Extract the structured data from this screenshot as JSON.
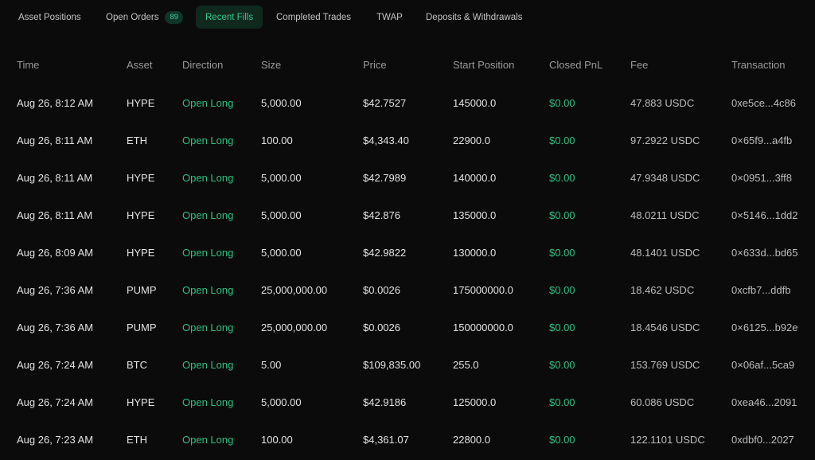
{
  "tabs": [
    {
      "label": "Asset Positions"
    },
    {
      "label": "Open Orders",
      "badge": "89"
    },
    {
      "label": "Recent Fills"
    },
    {
      "label": "Completed Trades"
    },
    {
      "label": "TWAP"
    },
    {
      "label": "Deposits & Withdrawals"
    }
  ],
  "table": {
    "headers": [
      "Time",
      "Asset",
      "Direction",
      "Size",
      "Price",
      "Start Position",
      "Closed PnL",
      "Fee",
      "Transaction"
    ],
    "rows": [
      {
        "time": "Aug 26, 8:12 AM",
        "asset": "HYPE",
        "direction": "Open Long",
        "size": "5,000.00",
        "price": "$42.7527",
        "start": "145000.0",
        "pnl": "$0.00",
        "fee": "47.883 USDC",
        "tx": "0xe5ce...4c86"
      },
      {
        "time": "Aug 26, 8:11 AM",
        "asset": "ETH",
        "direction": "Open Long",
        "size": "100.00",
        "price": "$4,343.40",
        "start": "22900.0",
        "pnl": "$0.00",
        "fee": "97.2922 USDC",
        "tx": "0×65f9...a4fb"
      },
      {
        "time": "Aug 26, 8:11 AM",
        "asset": "HYPE",
        "direction": "Open Long",
        "size": "5,000.00",
        "price": "$42.7989",
        "start": "140000.0",
        "pnl": "$0.00",
        "fee": "47.9348 USDC",
        "tx": "0×0951...3ff8"
      },
      {
        "time": "Aug 26, 8:11 AM",
        "asset": "HYPE",
        "direction": "Open Long",
        "size": "5,000.00",
        "price": "$42.876",
        "start": "135000.0",
        "pnl": "$0.00",
        "fee": "48.0211 USDC",
        "tx": "0×5146...1dd2"
      },
      {
        "time": "Aug 26, 8:09 AM",
        "asset": "HYPE",
        "direction": "Open Long",
        "size": "5,000.00",
        "price": "$42.9822",
        "start": "130000.0",
        "pnl": "$0.00",
        "fee": "48.1401 USDC",
        "tx": "0×633d...bd65"
      },
      {
        "time": "Aug 26, 7:36 AM",
        "asset": "PUMP",
        "direction": "Open Long",
        "size": "25,000,000.00",
        "price": "$0.0026",
        "start": "175000000.0",
        "pnl": "$0.00",
        "fee": "18.462 USDC",
        "tx": "0xcfb7...ddfb"
      },
      {
        "time": "Aug 26, 7:36 AM",
        "asset": "PUMP",
        "direction": "Open Long",
        "size": "25,000,000.00",
        "price": "$0.0026",
        "start": "150000000.0",
        "pnl": "$0.00",
        "fee": "18.4546 USDC",
        "tx": "0×6125...b92e"
      },
      {
        "time": "Aug 26, 7:24 AM",
        "asset": "BTC",
        "direction": "Open Long",
        "size": "5.00",
        "price": "$109,835.00",
        "start": "255.0",
        "pnl": "$0.00",
        "fee": "153.769 USDC",
        "tx": "0×06af...5ca9"
      },
      {
        "time": "Aug 26, 7:24 AM",
        "asset": "HYPE",
        "direction": "Open Long",
        "size": "5,000.00",
        "price": "$42.9186",
        "start": "125000.0",
        "pnl": "$0.00",
        "fee": "60.086 USDC",
        "tx": "0xea46...2091"
      },
      {
        "time": "Aug 26, 7:23 AM",
        "asset": "ETH",
        "direction": "Open Long",
        "size": "100.00",
        "price": "$4,361.07",
        "start": "22800.0",
        "pnl": "$0.00",
        "fee": "122.1101 USDC",
        "tx": "0xdbf0...2027"
      }
    ]
  },
  "colors": {
    "background": "#0b0b0b",
    "accent_green": "#2fbf82",
    "active_tab_bg": "#10291f"
  }
}
